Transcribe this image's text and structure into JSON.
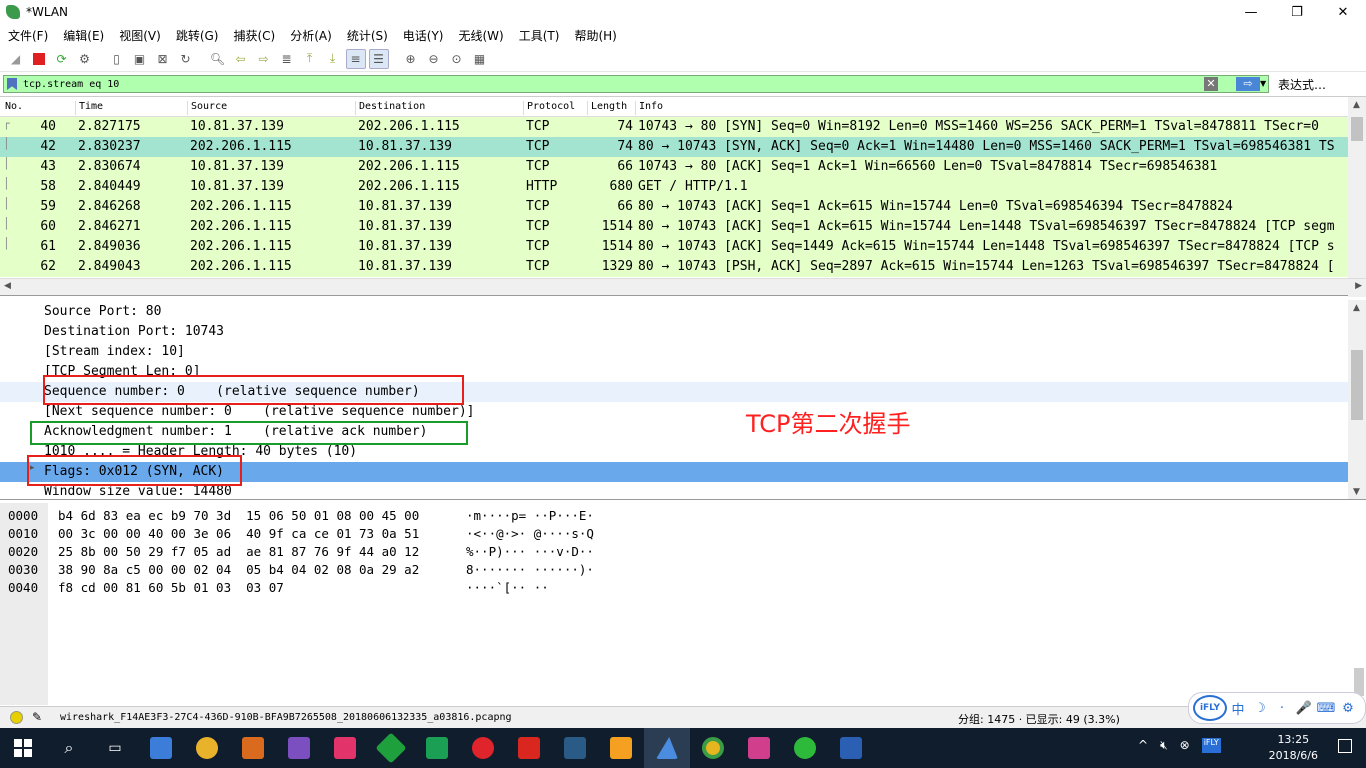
{
  "window": {
    "title": "*WLAN"
  },
  "menu": [
    "文件(F)",
    "编辑(E)",
    "视图(V)",
    "跳转(G)",
    "捕获(C)",
    "分析(A)",
    "统计(S)",
    "电话(Y)",
    "无线(W)",
    "工具(T)",
    "帮助(H)"
  ],
  "filter": {
    "value": "tcp.stream eq 10",
    "expression_label": "表达式…"
  },
  "columns": [
    "No.",
    "Time",
    "Source",
    "Destination",
    "Protocol",
    "Length",
    "Info"
  ],
  "packets": [
    {
      "no": "40",
      "time": "2.827175",
      "src": "10.81.37.139",
      "dst": "202.206.1.115",
      "proto": "TCP",
      "len": "74",
      "info": "10743 → 80 [SYN] Seq=0 Win=8192 Len=0 MSS=1460 WS=256 SACK_PERM=1 TSval=8478811 TSecr=0"
    },
    {
      "no": "42",
      "time": "2.830237",
      "src": "202.206.1.115",
      "dst": "10.81.37.139",
      "proto": "TCP",
      "len": "74",
      "info": "80 → 10743 [SYN, ACK] Seq=0 Ack=1 Win=14480 Len=0 MSS=1460 SACK_PERM=1 TSval=698546381 TS"
    },
    {
      "no": "43",
      "time": "2.830674",
      "src": "10.81.37.139",
      "dst": "202.206.1.115",
      "proto": "TCP",
      "len": "66",
      "info": "10743 → 80 [ACK] Seq=1 Ack=1 Win=66560 Len=0 TSval=8478814 TSecr=698546381"
    },
    {
      "no": "58",
      "time": "2.840449",
      "src": "10.81.37.139",
      "dst": "202.206.1.115",
      "proto": "HTTP",
      "len": "680",
      "info": "GET / HTTP/1.1"
    },
    {
      "no": "59",
      "time": "2.846268",
      "src": "202.206.1.115",
      "dst": "10.81.37.139",
      "proto": "TCP",
      "len": "66",
      "info": "80 → 10743 [ACK] Seq=1 Ack=615 Win=15744 Len=0 TSval=698546394 TSecr=8478824"
    },
    {
      "no": "60",
      "time": "2.846271",
      "src": "202.206.1.115",
      "dst": "10.81.37.139",
      "proto": "TCP",
      "len": "1514",
      "info": "80 → 10743 [ACK] Seq=1 Ack=615 Win=15744 Len=1448 TSval=698546397 TSecr=8478824 [TCP segm"
    },
    {
      "no": "61",
      "time": "2.849036",
      "src": "202.206.1.115",
      "dst": "10.81.37.139",
      "proto": "TCP",
      "len": "1514",
      "info": "80 → 10743 [ACK] Seq=1449 Ack=615 Win=15744 Len=1448 TSval=698546397 TSecr=8478824 [TCP s"
    },
    {
      "no": "62",
      "time": "2.849043",
      "src": "202.206.1.115",
      "dst": "10.81.37.139",
      "proto": "TCP",
      "len": "1329",
      "info": "80 → 10743 [PSH, ACK] Seq=2897 Ack=615 Win=15744 Len=1263 TSval=698546397 TSecr=8478824 ["
    }
  ],
  "details": [
    "Source Port: 80",
    "Destination Port: 10743",
    "[Stream index: 10]",
    "[TCP Segment Len: 0]",
    "Sequence number: 0    (relative sequence number)",
    "[Next sequence number: 0    (relative sequence number)]",
    "Acknowledgment number: 1    (relative ack number)",
    "1010 .... = Header Length: 40 bytes (10)",
    "Flags: 0x012 (SYN, ACK)",
    "Window size value: 14480"
  ],
  "annotation": "TCP第二次握手",
  "hexdump": [
    {
      "off": "0000",
      "hex": "b4 6d 83 ea ec b9 70 3d  15 06 50 01 08 00 45 00",
      "ascii": "·m····p= ··P···E·"
    },
    {
      "off": "0010",
      "hex": "00 3c 00 00 40 00 3e 06  40 9f ca ce 01 73 0a 51",
      "ascii": "·<··@·>· @····s·Q"
    },
    {
      "off": "0020",
      "hex": "25 8b 00 50 29 f7 05 ad  ae 81 87 76 9f 44 a0 12",
      "ascii": "%··P)··· ···v·D··"
    },
    {
      "off": "0030",
      "hex": "38 90 8a c5 00 00 02 04  05 b4 04 02 08 0a 29 a2",
      "ascii": "8······· ······)·"
    },
    {
      "off": "0040",
      "hex": "f8 cd 00 81 60 5b 01 03  03 07",
      "ascii": "····`[·· ··"
    }
  ],
  "status": {
    "file": "wireshark_F14AE3F3-27C4-436D-910B-BFA9B7265508_20180606132335_a03816.pcapng",
    "packets": "分组: 1475 · 已显示: 49 (3.3%)"
  },
  "ime": [
    "中",
    "☽",
    "·",
    "🎤",
    "⌨",
    "⚙"
  ],
  "clock": {
    "time": "13:25",
    "date": "2018/6/6"
  },
  "colors": {
    "row_bg": "#e4ffc7",
    "selected_row": "#a3e4d0",
    "filter_bg": "#afffaf",
    "highlight": "#6aa8ec",
    "red_box": "#e8201b",
    "green_box": "#1a9c28"
  }
}
